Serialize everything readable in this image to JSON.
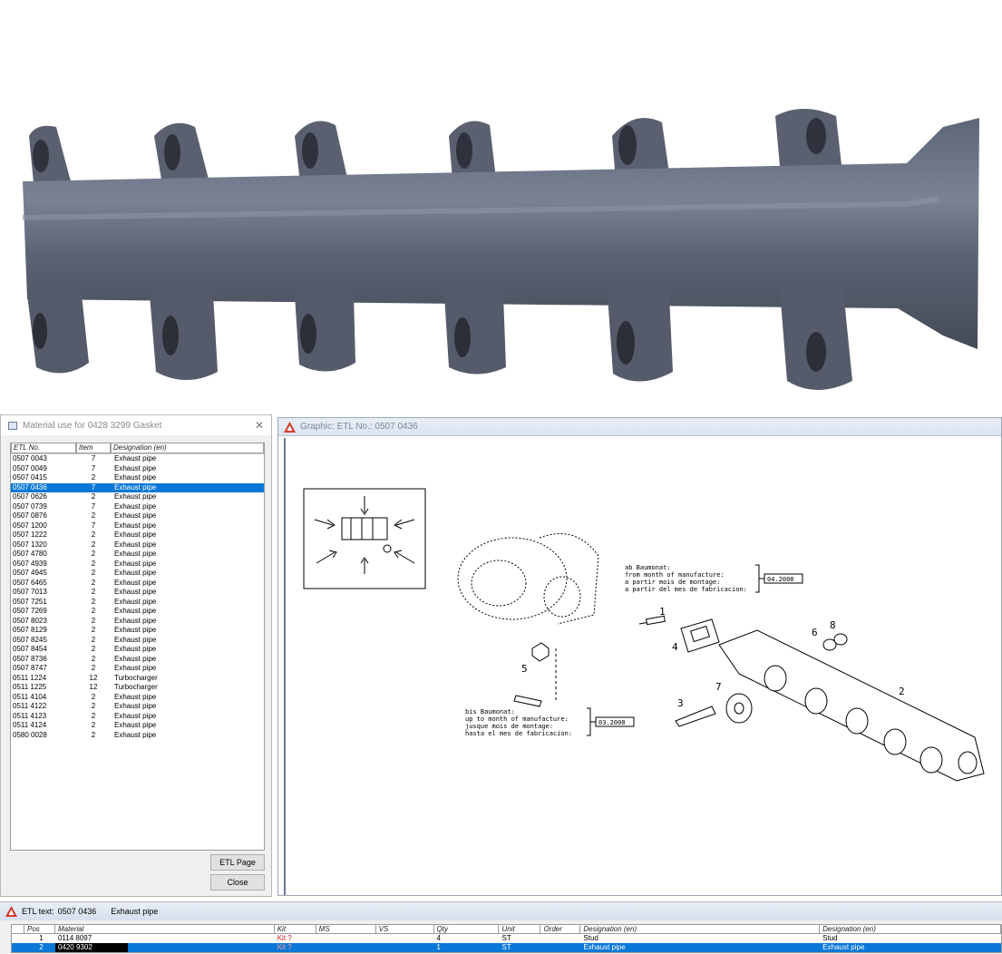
{
  "dialog": {
    "title": "Material use for 0428 3299 Gasket",
    "columns": [
      "ETL No.",
      "Item",
      "Designation (en)"
    ],
    "selected_index": 3,
    "rows": [
      [
        "0507 0043",
        "7",
        "Exhaust pipe"
      ],
      [
        "0507 0049",
        "7",
        "Exhaust pipe"
      ],
      [
        "0507 0415",
        "2",
        "Exhaust pipe"
      ],
      [
        "0507 0436",
        "7",
        "Exhaust pipe"
      ],
      [
        "0507 0626",
        "2",
        "Exhaust pipe"
      ],
      [
        "0507 0739",
        "7",
        "Exhaust pipe"
      ],
      [
        "0507 0876",
        "2",
        "Exhaust pipe"
      ],
      [
        "0507 1200",
        "7",
        "Exhaust pipe"
      ],
      [
        "0507 1222",
        "2",
        "Exhaust pipe"
      ],
      [
        "0507 1320",
        "2",
        "Exhaust pipe"
      ],
      [
        "0507 4780",
        "2",
        "Exhaust pipe"
      ],
      [
        "0507 4939",
        "2",
        "Exhaust pipe"
      ],
      [
        "0507 4945",
        "2",
        "Exhaust pipe"
      ],
      [
        "0507 6465",
        "2",
        "Exhaust pipe"
      ],
      [
        "0507 7013",
        "2",
        "Exhaust pipe"
      ],
      [
        "0507 7251",
        "2",
        "Exhaust pipe"
      ],
      [
        "0507 7269",
        "2",
        "Exhaust pipe"
      ],
      [
        "0507 8023",
        "2",
        "Exhaust pipe"
      ],
      [
        "0507 8129",
        "2",
        "Exhaust pipe"
      ],
      [
        "0507 8245",
        "2",
        "Exhaust pipe"
      ],
      [
        "0507 8454",
        "2",
        "Exhaust pipe"
      ],
      [
        "0507 8736",
        "2",
        "Exhaust pipe"
      ],
      [
        "0507 8747",
        "2",
        "Exhaust pipe"
      ],
      [
        "0511 1224",
        "12",
        "Turbocharger"
      ],
      [
        "0511 1225",
        "12",
        "Turbocharger"
      ],
      [
        "0511 4104",
        "2",
        "Exhaust pipe"
      ],
      [
        "0511 4122",
        "2",
        "Exhaust pipe"
      ],
      [
        "0511 4123",
        "2",
        "Exhaust pipe"
      ],
      [
        "0511 4124",
        "2",
        "Exhaust pipe"
      ],
      [
        "0580 0028",
        "2",
        "Exhaust pipe"
      ]
    ],
    "etl_page_button": "ETL Page",
    "close_button": "Close",
    "close_glyph": "✕"
  },
  "graphic": {
    "title": "Graphic: ETL No.: 0507 0436",
    "note_from": [
      "ab Baumonat:",
      "from month of manufacture:",
      "a partir mois de montage:",
      "a partir del mes de fabricacion:"
    ],
    "note_from_date": "04.2008",
    "note_to": [
      "bis Baumonat:",
      "up to month of manufacture:",
      "jusque mois de montage:",
      "hasta el mes de fabricacion:"
    ],
    "note_to_date": "03.2008",
    "callouts": [
      "1",
      "2",
      "3",
      "4",
      "5",
      "6",
      "7",
      "8"
    ]
  },
  "etl": {
    "title_prefix": "ETL text:",
    "etl_no": "0507 0436",
    "designation": "Exhaust pipe",
    "columns": [
      "Pos",
      "Material",
      "Kit",
      "MS",
      "VS",
      "Qty",
      "Unit",
      "Order",
      "Designation (en)",
      "Designation (en)"
    ],
    "rows": [
      [
        "1",
        "0114 8097",
        "Kit ?",
        "",
        "",
        "4",
        "ST",
        "",
        "Stud",
        "Stud"
      ],
      [
        "2",
        "0420 9302",
        "Kit ?",
        "",
        "",
        "1",
        "ST",
        "",
        "Exhaust pipe",
        "Exhaust pipe"
      ]
    ],
    "selected_index": 1
  },
  "colors": {
    "selection": "#0a78d7",
    "kit": "#c82020"
  }
}
